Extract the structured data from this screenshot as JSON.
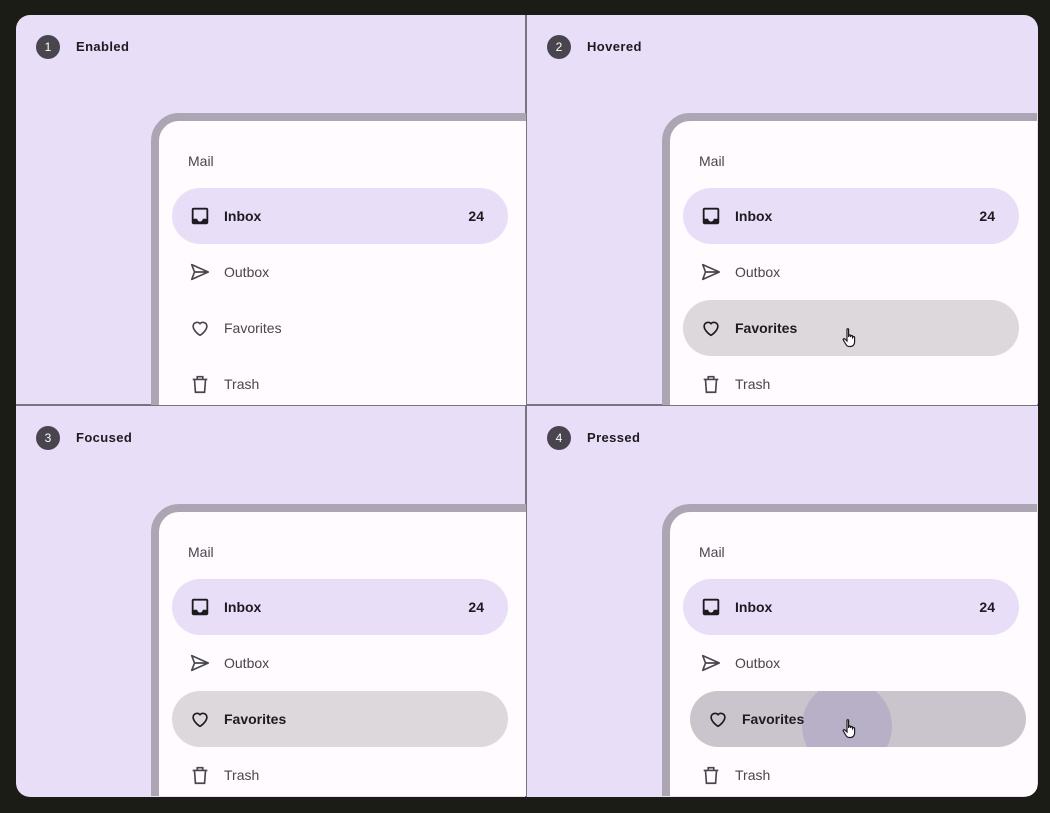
{
  "colors": {
    "background": "#e8def8",
    "active_indicator": "#e8def8",
    "hover_state": "#dcd8dc",
    "pressed_state": "#cac5cc",
    "ripple": "#b4acc6",
    "badge": "#49454f"
  },
  "quadrants": [
    {
      "number": "1",
      "state": "Enabled"
    },
    {
      "number": "2",
      "state": "Hovered"
    },
    {
      "number": "3",
      "state": "Focused"
    },
    {
      "number": "4",
      "state": "Pressed"
    }
  ],
  "drawer": {
    "headline": "Mail",
    "items": [
      {
        "label": "Inbox",
        "icon": "inbox-icon",
        "count": "24"
      },
      {
        "label": "Outbox",
        "icon": "send-icon"
      },
      {
        "label": "Favorites",
        "icon": "heart-icon"
      },
      {
        "label": "Trash",
        "icon": "trash-icon"
      }
    ]
  }
}
